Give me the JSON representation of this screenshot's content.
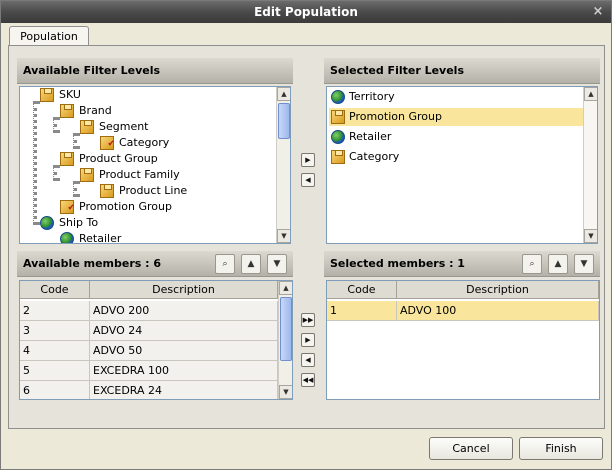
{
  "window": {
    "title": "Edit Population",
    "close_glyph": "×"
  },
  "tabs": [
    {
      "label": "Population"
    }
  ],
  "available_levels": {
    "header": "Available Filter Levels",
    "items": [
      {
        "label": "SKU",
        "icon": "cube-icon"
      },
      {
        "label": "Brand",
        "icon": "cube-icon"
      },
      {
        "label": "Segment",
        "icon": "cube-icon"
      },
      {
        "label": "Category",
        "icon": "cube-check-icon"
      },
      {
        "label": "Product Group",
        "icon": "cube-icon"
      },
      {
        "label": "Product Family",
        "icon": "cube-icon"
      },
      {
        "label": "Product Line",
        "icon": "cube-icon"
      },
      {
        "label": "Promotion Group",
        "icon": "cube-check-icon"
      },
      {
        "label": "Ship To",
        "icon": "globe-icon"
      },
      {
        "label": "Retailer",
        "icon": "globe-check-icon"
      }
    ]
  },
  "selected_levels": {
    "header": "Selected Filter Levels",
    "items": [
      {
        "label": "Territory",
        "icon": "globe-icon",
        "selected": false
      },
      {
        "label": "Promotion Group",
        "icon": "cube-icon",
        "selected": true
      },
      {
        "label": "Retailer",
        "icon": "globe-icon",
        "selected": false
      },
      {
        "label": "Category",
        "icon": "cube-icon",
        "selected": false
      }
    ]
  },
  "available_members": {
    "header": "Available members : 6",
    "columns": [
      "Code",
      "Description"
    ],
    "rows": [
      {
        "code": "2",
        "description": "ADVO 200"
      },
      {
        "code": "3",
        "description": "ADVO 24"
      },
      {
        "code": "4",
        "description": "ADVO 50"
      },
      {
        "code": "5",
        "description": "EXCEDRA 100"
      },
      {
        "code": "6",
        "description": "EXCEDRA 24"
      }
    ]
  },
  "selected_members": {
    "header": "Selected members : 1",
    "columns": [
      "Code",
      "Description"
    ],
    "rows": [
      {
        "code": "1",
        "description": "ADVO 100"
      }
    ]
  },
  "transfer_buttons": {
    "add": "▶",
    "remove": "◀",
    "add_all": "▶▶",
    "add_one": "▶",
    "remove_one": "◀",
    "remove_all": "◀◀"
  },
  "scroll": {
    "up": "▲",
    "down": "▼"
  },
  "tools": {
    "search": "⌕",
    "hierarchy": "▲",
    "filter": "▼"
  },
  "footer": {
    "cancel_label": "Cancel",
    "finish_label": "Finish"
  },
  "colors": {
    "selection": "#f9e59b",
    "titlebar": "#4a4a4a"
  }
}
